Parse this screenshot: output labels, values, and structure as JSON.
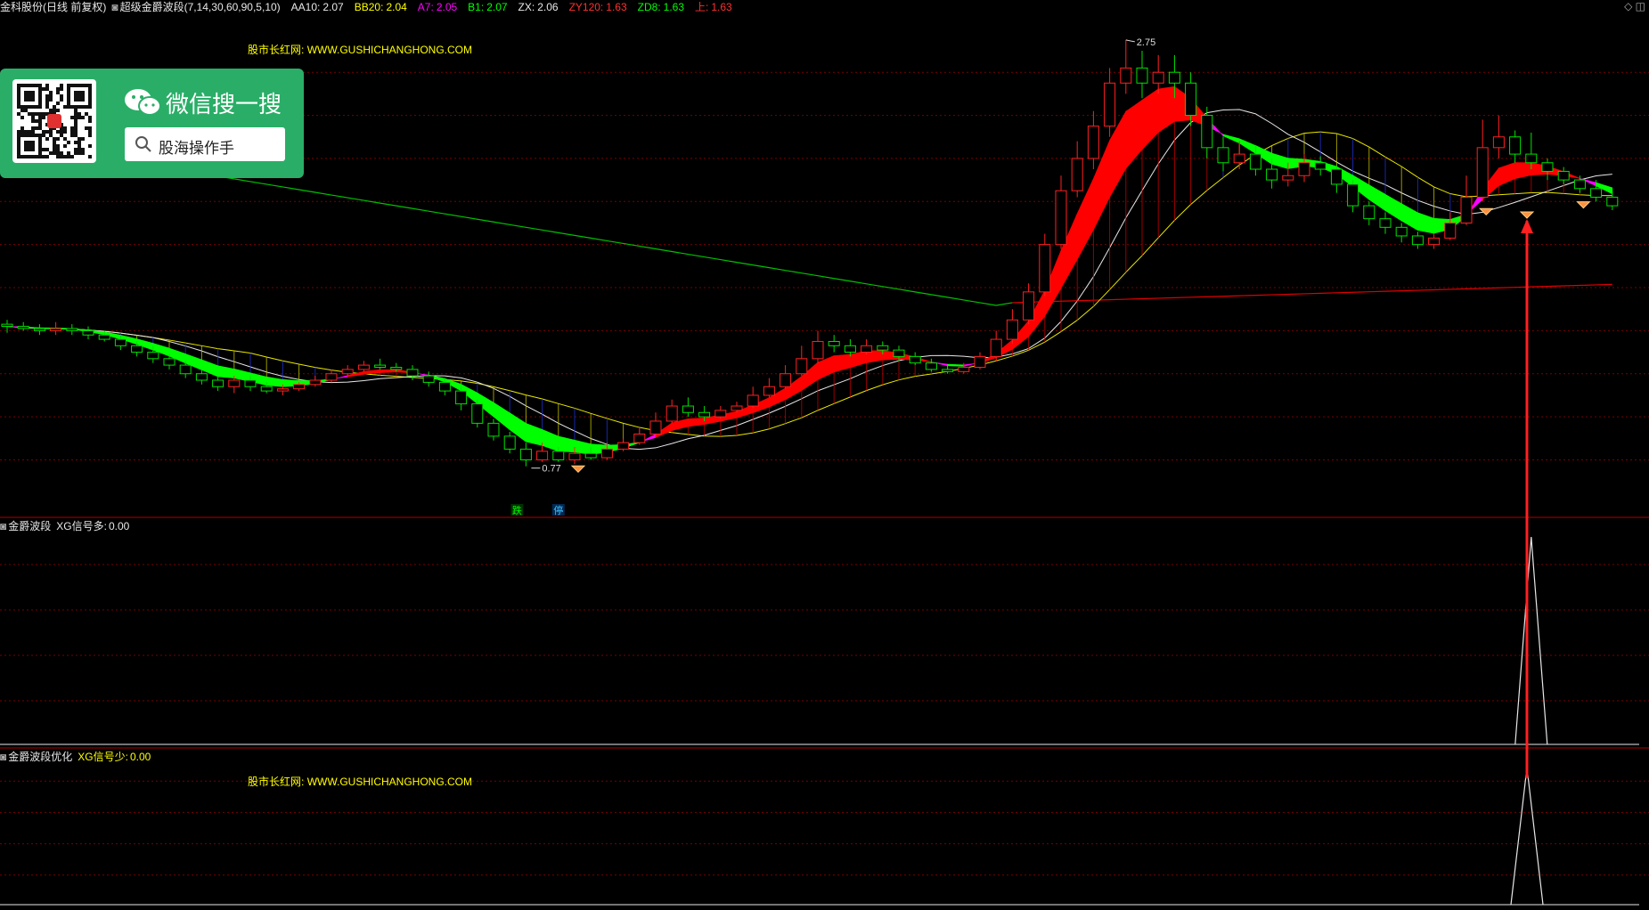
{
  "header": {
    "stock": "金科股份(日线 前复权)",
    "indicator": "超级金爵波段(7,14,30,60,90,5,10)",
    "values": [
      {
        "label": "AA10:",
        "value": "2.07",
        "color": "#e8e8e8"
      },
      {
        "label": "BB20:",
        "value": "2.04",
        "color": "#ffff00"
      },
      {
        "label": "A7:",
        "value": "2.05",
        "color": "#ff00ff"
      },
      {
        "label": "B1:",
        "value": "2.07",
        "color": "#00ff00"
      },
      {
        "label": "ZX:",
        "value": "2.06",
        "color": "#e8e8e8"
      },
      {
        "label": "ZY120:",
        "value": "1.63",
        "color": "#ff3030"
      },
      {
        "label": "ZD8:",
        "value": "1.63",
        "color": "#00ff00"
      },
      {
        "label": "上:",
        "value": "1.63",
        "color": "#ff3030"
      }
    ],
    "icons": "◇ ◫"
  },
  "watermark": {
    "site_label": "股市长红网:",
    "url": "WWW.GUSHICHANGHONG.COM"
  },
  "wechat": {
    "title": "微信搜一搜",
    "search_text": "股海操作手"
  },
  "panel2": {
    "name": "金爵波段",
    "series": "XG信号多:",
    "value": "0.00"
  },
  "panel3": {
    "name": "金爵波段优化",
    "series": "XG信号少:",
    "value": "0.00"
  },
  "annotations": {
    "high": "2.75",
    "low": "0.77",
    "tag_die": "跌",
    "tag_ting": "停"
  },
  "colors": {
    "up": "#ff2020",
    "down": "#00e000",
    "band_red": "#ff0000",
    "band_green": "#00ff00",
    "magenta": "#ff00ff",
    "grid": "#7a0000",
    "sep": "#b00000"
  },
  "chart_data": {
    "type": "candlestick",
    "candles": [
      [
        1.43,
        1.42,
        1.45,
        1.39
      ],
      [
        1.42,
        1.41,
        1.44,
        1.4
      ],
      [
        1.41,
        1.4,
        1.43,
        1.38
      ],
      [
        1.4,
        1.41,
        1.44,
        1.38
      ],
      [
        1.41,
        1.4,
        1.43,
        1.38
      ],
      [
        1.4,
        1.38,
        1.42,
        1.36
      ],
      [
        1.38,
        1.36,
        1.4,
        1.35
      ],
      [
        1.36,
        1.33,
        1.38,
        1.31
      ],
      [
        1.33,
        1.3,
        1.35,
        1.28
      ],
      [
        1.3,
        1.27,
        1.33,
        1.25
      ],
      [
        1.27,
        1.24,
        1.29,
        1.22
      ],
      [
        1.24,
        1.2,
        1.26,
        1.18
      ],
      [
        1.2,
        1.17,
        1.22,
        1.15
      ],
      [
        1.17,
        1.14,
        1.19,
        1.12
      ],
      [
        1.14,
        1.17,
        1.19,
        1.11
      ],
      [
        1.17,
        1.14,
        1.19,
        1.12
      ],
      [
        1.14,
        1.12,
        1.16,
        1.11
      ],
      [
        1.12,
        1.13,
        1.15,
        1.1
      ],
      [
        1.13,
        1.15,
        1.16,
        1.12
      ],
      [
        1.15,
        1.17,
        1.19,
        1.14
      ],
      [
        1.17,
        1.2,
        1.22,
        1.16
      ],
      [
        1.2,
        1.22,
        1.24,
        1.19
      ],
      [
        1.22,
        1.24,
        1.26,
        1.21
      ],
      [
        1.24,
        1.23,
        1.27,
        1.22
      ],
      [
        1.23,
        1.22,
        1.25,
        1.21
      ],
      [
        1.22,
        1.19,
        1.24,
        1.17
      ],
      [
        1.19,
        1.16,
        1.21,
        1.14
      ],
      [
        1.16,
        1.12,
        1.18,
        1.1
      ],
      [
        1.12,
        1.06,
        1.14,
        1.03
      ],
      [
        1.06,
        0.97,
        1.08,
        0.95
      ],
      [
        0.97,
        0.91,
        0.99,
        0.89
      ],
      [
        0.91,
        0.85,
        0.93,
        0.83
      ],
      [
        0.85,
        0.8,
        0.88,
        0.77
      ],
      [
        0.8,
        0.84,
        0.88,
        0.79
      ],
      [
        0.84,
        0.8,
        0.86,
        0.79
      ],
      [
        0.8,
        0.83,
        0.86,
        0.78
      ],
      [
        0.83,
        0.81,
        0.86,
        0.8
      ],
      [
        0.81,
        0.85,
        0.88,
        0.8
      ],
      [
        0.85,
        0.88,
        0.9,
        0.84
      ],
      [
        0.88,
        0.92,
        0.95,
        0.87
      ],
      [
        0.92,
        0.98,
        1.02,
        0.91
      ],
      [
        0.98,
        1.05,
        1.08,
        0.97
      ],
      [
        1.05,
        1.02,
        1.09,
        1.0
      ],
      [
        1.02,
        1.0,
        1.05,
        0.98
      ],
      [
        1.0,
        1.03,
        1.05,
        0.99
      ],
      [
        1.03,
        1.05,
        1.07,
        1.02
      ],
      [
        1.05,
        1.1,
        1.14,
        1.04
      ],
      [
        1.1,
        1.14,
        1.18,
        1.09
      ],
      [
        1.14,
        1.2,
        1.24,
        1.13
      ],
      [
        1.2,
        1.27,
        1.33,
        1.19
      ],
      [
        1.27,
        1.35,
        1.4,
        1.25
      ],
      [
        1.35,
        1.33,
        1.38,
        1.3
      ],
      [
        1.33,
        1.3,
        1.36,
        1.28
      ],
      [
        1.3,
        1.33,
        1.36,
        1.29
      ],
      [
        1.33,
        1.31,
        1.35,
        1.29
      ],
      [
        1.31,
        1.28,
        1.33,
        1.26
      ],
      [
        1.28,
        1.25,
        1.3,
        1.24
      ],
      [
        1.25,
        1.22,
        1.27,
        1.21
      ],
      [
        1.22,
        1.21,
        1.24,
        1.2
      ],
      [
        1.21,
        1.23,
        1.25,
        1.2
      ],
      [
        1.23,
        1.28,
        1.3,
        1.22
      ],
      [
        1.28,
        1.36,
        1.4,
        1.26
      ],
      [
        1.36,
        1.45,
        1.5,
        1.34
      ],
      [
        1.45,
        1.58,
        1.62,
        1.43
      ],
      [
        1.58,
        1.8,
        1.85,
        1.56
      ],
      [
        1.8,
        2.05,
        2.12,
        1.78
      ],
      [
        2.05,
        2.2,
        2.28,
        2.02
      ],
      [
        2.2,
        2.35,
        2.42,
        2.15
      ],
      [
        2.35,
        2.55,
        2.62,
        2.3
      ],
      [
        2.55,
        2.62,
        2.75,
        2.5
      ],
      [
        2.62,
        2.55,
        2.7,
        2.48
      ],
      [
        2.55,
        2.6,
        2.68,
        2.5
      ],
      [
        2.6,
        2.55,
        2.68,
        2.48
      ],
      [
        2.55,
        2.4,
        2.6,
        2.35
      ],
      [
        2.4,
        2.25,
        2.44,
        2.2
      ],
      [
        2.25,
        2.18,
        2.3,
        2.14
      ],
      [
        2.18,
        2.22,
        2.28,
        2.15
      ],
      [
        2.22,
        2.15,
        2.26,
        2.12
      ],
      [
        2.15,
        2.1,
        2.2,
        2.06
      ],
      [
        2.1,
        2.12,
        2.18,
        2.07
      ],
      [
        2.12,
        2.18,
        2.22,
        2.09
      ],
      [
        2.18,
        2.15,
        2.21,
        2.12
      ],
      [
        2.15,
        2.08,
        2.17,
        2.04
      ],
      [
        2.08,
        1.98,
        2.1,
        1.95
      ],
      [
        1.98,
        1.92,
        2.0,
        1.89
      ],
      [
        1.92,
        1.88,
        1.95,
        1.85
      ],
      [
        1.88,
        1.84,
        1.9,
        1.81
      ],
      [
        1.84,
        1.8,
        1.86,
        1.78
      ],
      [
        1.8,
        1.83,
        1.85,
        1.78
      ],
      [
        1.83,
        1.9,
        1.95,
        1.82
      ],
      [
        1.9,
        2.02,
        2.12,
        1.89
      ],
      [
        2.02,
        2.25,
        2.38,
        2.0
      ],
      [
        2.25,
        2.3,
        2.4,
        2.2
      ],
      [
        2.3,
        2.22,
        2.33,
        2.18
      ],
      [
        2.22,
        2.18,
        2.32,
        2.15
      ],
      [
        2.18,
        2.14,
        2.2,
        2.1
      ],
      [
        2.14,
        2.1,
        2.16,
        2.08
      ],
      [
        2.1,
        2.06,
        2.12,
        2.04
      ],
      [
        2.06,
        2.02,
        2.1,
        2.0
      ],
      [
        2.02,
        1.98,
        2.05,
        1.96
      ]
    ],
    "annotations": {
      "high": 2.75,
      "low": 0.77
    },
    "panel2_signal_peak_index": 94,
    "panel3_signal_peak_index": 100
  }
}
